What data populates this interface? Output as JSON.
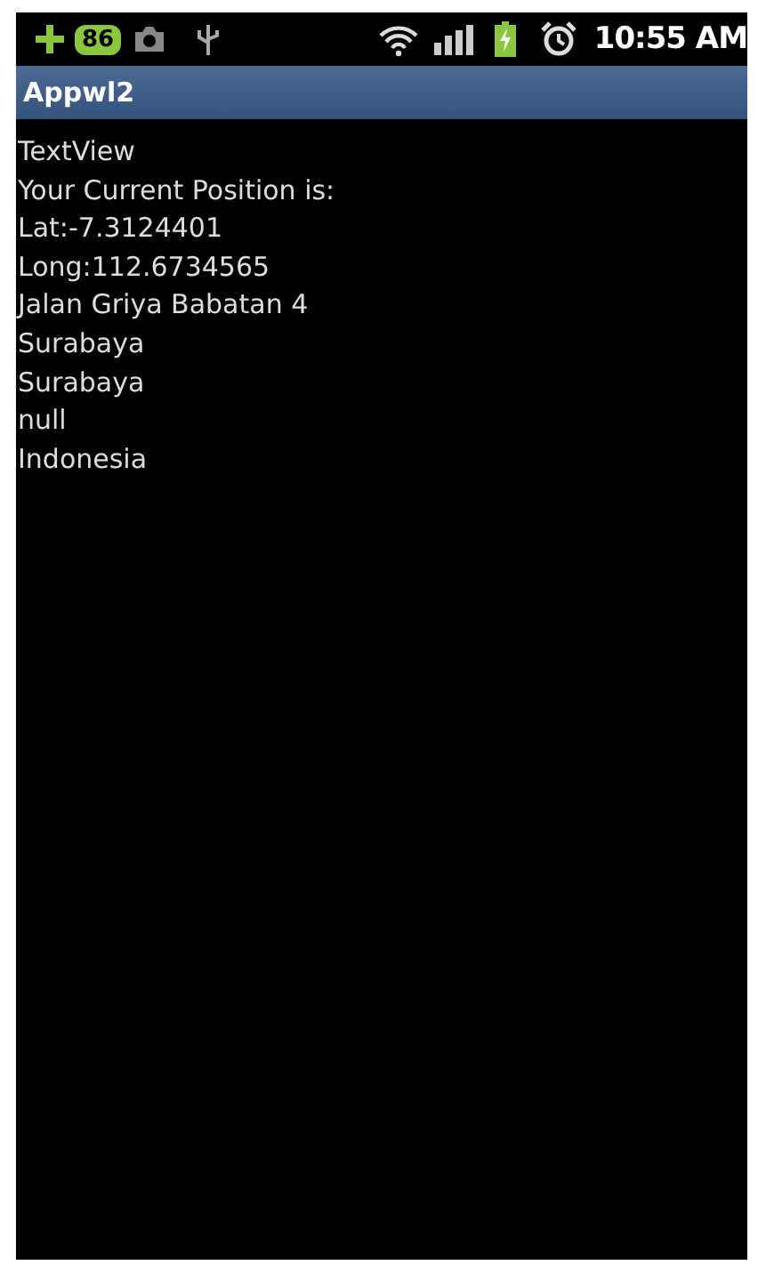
{
  "status_bar": {
    "notification_count": "86",
    "time": "10:55 AM"
  },
  "window": {
    "title": "Appwl2"
  },
  "lines": [
    "TextView",
    "Your Current Position is:",
    "Lat:-7.3124401",
    "Long:112.6734565",
    "Jalan Griya Babatan 4",
    "Surabaya",
    "Surabaya",
    "null",
    "Indonesia"
  ]
}
